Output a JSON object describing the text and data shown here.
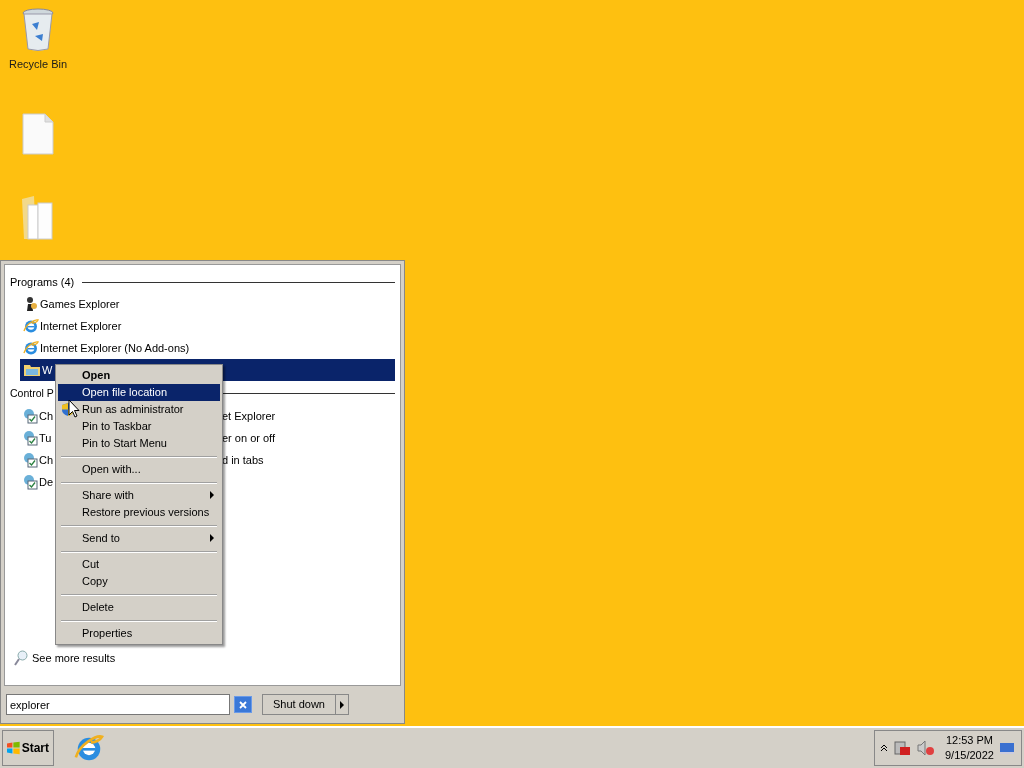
{
  "desktop": {
    "icons": [
      {
        "kind": "recycle",
        "label": "Recycle Bin"
      },
      {
        "kind": "file"
      },
      {
        "kind": "folder"
      }
    ]
  },
  "start_menu": {
    "programs_header": "Programs (4)",
    "programs": [
      {
        "kind": "games",
        "label": "Games Explorer",
        "selected": false
      },
      {
        "kind": "ie",
        "label": "Internet Explorer",
        "selected": false
      },
      {
        "kind": "ie",
        "label": "Internet Explorer (No Add-ons)",
        "selected": false
      },
      {
        "kind": "folder",
        "label": "W",
        "selected": true
      }
    ],
    "control_panel_header": "Control P",
    "control_panel": [
      {
        "left": "Ch",
        "right": "et Explorer"
      },
      {
        "left": "Tu",
        "right": "er on or off"
      },
      {
        "left": "Ch",
        "right": "d in tabs"
      },
      {
        "left": "De"
      }
    ],
    "see_more": "See more results",
    "search": {
      "value": "explorer"
    },
    "shutdown": "Shut down"
  },
  "context_menu": [
    {
      "kind": "default",
      "label": "Open",
      "selected": false
    },
    {
      "kind": "item",
      "label": "Open file location",
      "selected": true
    },
    {
      "kind": "elevated",
      "label": "Run as administrator",
      "selected": false
    },
    {
      "kind": "item",
      "label": "Pin to Taskbar",
      "selected": false
    },
    {
      "kind": "item",
      "label": "Pin to Start Menu",
      "selected": false
    },
    {
      "kind": "separator"
    },
    {
      "kind": "item",
      "label": "Open with...",
      "selected": false
    },
    {
      "kind": "separator"
    },
    {
      "kind": "submenu",
      "label": "Share with",
      "selected": false
    },
    {
      "kind": "item",
      "label": "Restore previous versions",
      "selected": false
    },
    {
      "kind": "separator"
    },
    {
      "kind": "submenu",
      "label": "Send to",
      "selected": false
    },
    {
      "kind": "separator"
    },
    {
      "kind": "item",
      "label": "Cut",
      "selected": false
    },
    {
      "kind": "item",
      "label": "Copy",
      "selected": false
    },
    {
      "kind": "separator"
    },
    {
      "kind": "item",
      "label": "Delete",
      "selected": false
    },
    {
      "kind": "separator"
    },
    {
      "kind": "item",
      "label": "Properties",
      "selected": false
    }
  ],
  "taskbar": {
    "start": "Start",
    "time": "12:53 PM",
    "date": "9/15/2022"
  }
}
